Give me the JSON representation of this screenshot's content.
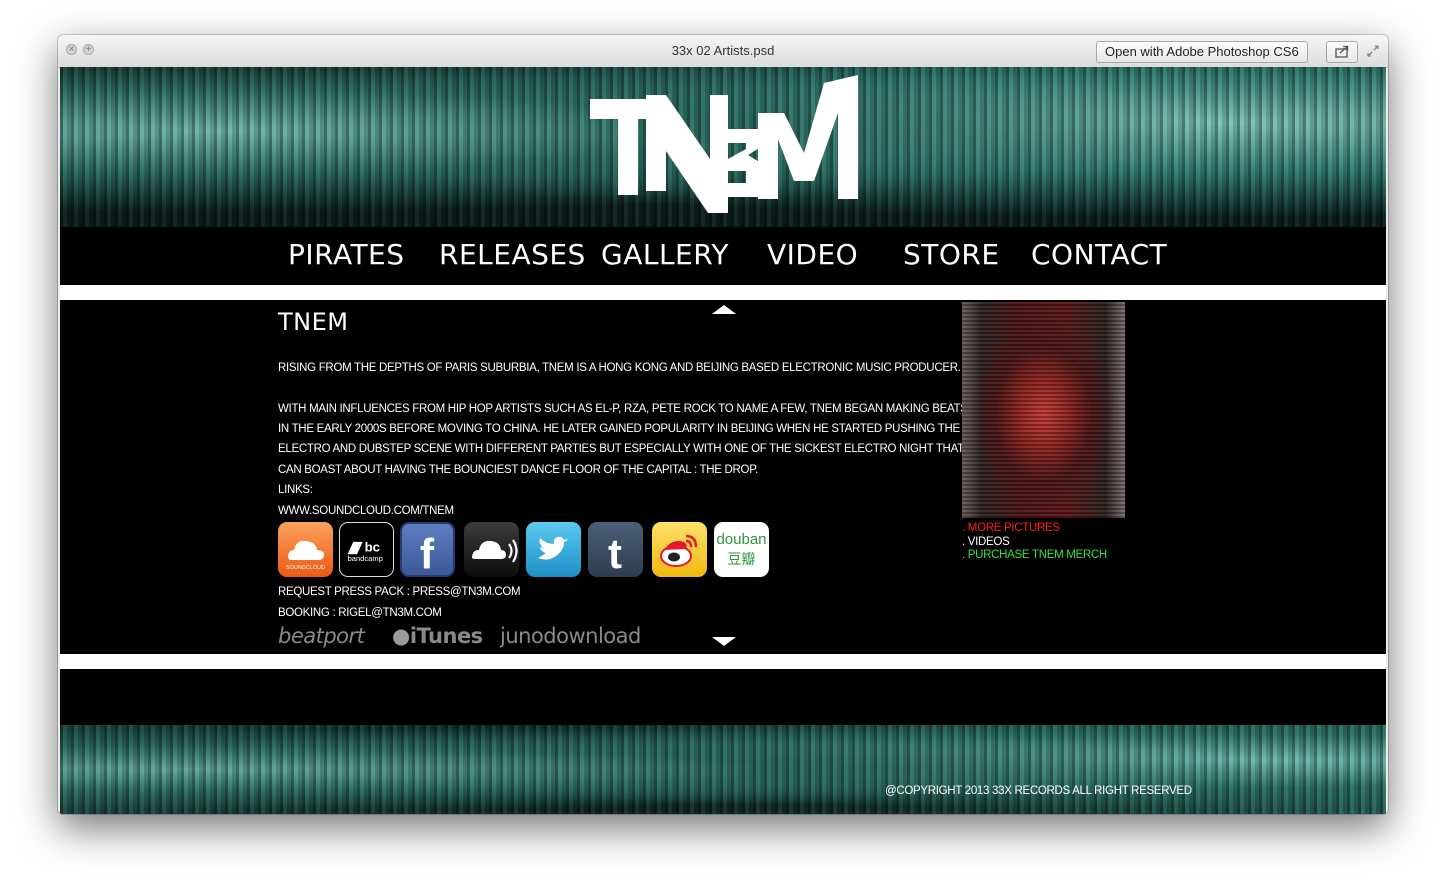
{
  "window": {
    "title": "33x 02 Artists.psd",
    "open_with_label": "Open with Adobe Photoshop CS6"
  },
  "site": {
    "logo_text": "TN3M",
    "nav": [
      "PIRATES",
      "RELEASES",
      "GALLERY",
      "VIDEO",
      "STORE",
      "CONTACT"
    ]
  },
  "artist": {
    "name": "TNEM",
    "bio_1": "RISING FROM THE DEPTHS OF PARIS SUBURBIA, TNEM IS A HONG KONG AND BEIJING BASED ELECTRONIC MUSIC PRODUCER.",
    "bio_2_lines": [
      "WITH MAIN INFLUENCES FROM HIP HOP ARTISTS SUCH AS EL-P, RZA, PETE ROCK TO NAME A FEW, TNEM BEGAN MAKING BEATS",
      " IN THE EARLY 2000S BEFORE MOVING TO CHINA. HE LATER GAINED POPULARITY IN BEIJING WHEN HE STARTED PUSHING THE",
      "ELECTRO AND DUBSTEP SCENE WITH DIFFERENT PARTIES BUT ESPECIALLY WITH ONE OF THE SICKEST ELECTRO NIGHT THAT",
      "CAN BOAST ABOUT HAVING THE BOUNCIEST DANCE FLOOR OF THE CAPITAL : THE DROP."
    ],
    "links_label": "LINKS:",
    "link_url": "WWW.SOUNDCLOUD.COM/TNEM",
    "press": "REQUEST PRESS PACK :  PRESS@TN3M.COM",
    "booking": "BOOKING : RIGEL@TN3M.COM"
  },
  "social_icons": [
    {
      "name": "soundcloud-icon",
      "label": "SOUNDCLOUD",
      "color": "#f26f23"
    },
    {
      "name": "bandcamp-icon",
      "label": "bandcamp",
      "color": "#000000"
    },
    {
      "name": "facebook-icon",
      "label": "f",
      "color": "#3b5998"
    },
    {
      "name": "cloud-icon",
      "label": "",
      "color": "#1a1a1a"
    },
    {
      "name": "twitter-icon",
      "label": "",
      "color": "#2aa9e0"
    },
    {
      "name": "tumblr-icon",
      "label": "t",
      "color": "#35465c"
    },
    {
      "name": "weibo-icon",
      "label": "",
      "color": "#f5c518"
    },
    {
      "name": "douban-icon",
      "label": "douban",
      "sublabel": "豆瓣",
      "color": "#ffffff"
    }
  ],
  "stores": [
    "beatport",
    "iTunes",
    "junodownload"
  ],
  "side": {
    "more_pictures": ". MORE PICTURES",
    "videos": ". VIDEOS",
    "merch": ". PURCHASE TNEM MERCH",
    "more_pictures_color": "#ff2020",
    "videos_color": "#ffffff",
    "merch_color": "#33e24a"
  },
  "footer": {
    "copyright": "@COPYRIGHT 2013 33X RECORDS ALL RIGHT RESERVED"
  }
}
